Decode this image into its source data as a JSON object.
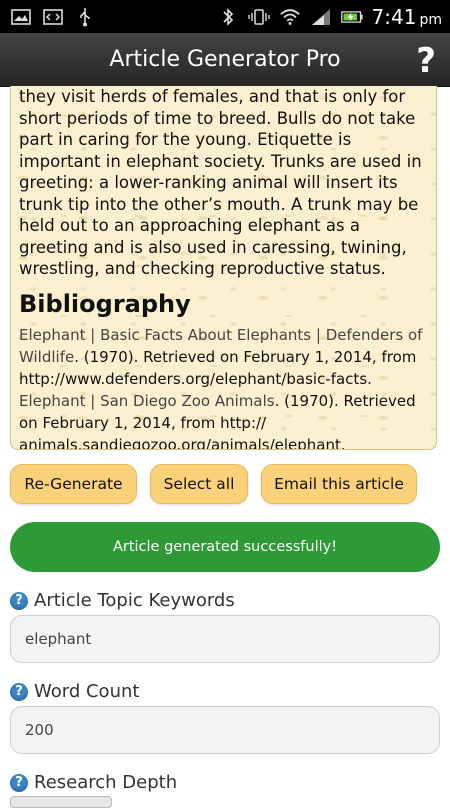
{
  "status_bar": {
    "time": "7:41",
    "ampm": "pm"
  },
  "action_bar": {
    "title": "Article Generator Pro",
    "help_label": "?"
  },
  "article": {
    "body": "they visit herds of females, and that is only for short periods of time to breed. Bulls do not take part in caring for the young. Etiquette is important in elephant society. Trunks are used in greeting: a lower-ranking animal will insert its trunk tip into the other’s mouth. A trunk may be held out to an approaching elephant as a greeting and is also used in caressing, twining, wrestling, and checking reproductive status.",
    "bibliography_heading": "Bibliography",
    "bibliography": [
      {
        "link": "Elephant | Basic Facts About Elephants | Defenders of Wildlife",
        "text": ". (1970). Retrieved on February 1, 2014, from http://www.defenders.org/elephant/basic-facts."
      },
      {
        "link": "Elephant | San Diego Zoo Animals",
        "text": ". (1970). Retrieved on February 1, 2014, from http:// animals.sandiegozoo.org/animals/elephant."
      }
    ]
  },
  "buttons": {
    "regenerate": "Re-Generate",
    "select_all": "Select all",
    "email": "Email this article"
  },
  "success_message": "Article generated successfully!",
  "form": {
    "keywords": {
      "label": "Article Topic Keywords",
      "value": "elephant"
    },
    "word_count": {
      "label": "Word Count",
      "value": "200"
    },
    "research_depth": {
      "label": "Research Depth"
    }
  }
}
